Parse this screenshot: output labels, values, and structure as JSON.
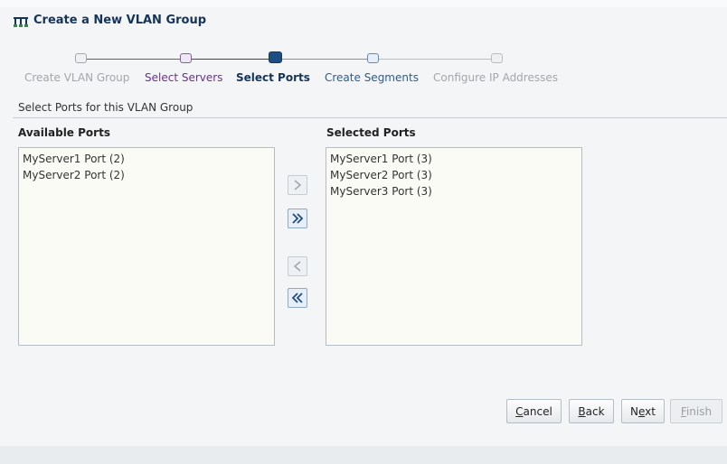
{
  "header": {
    "title": "Create a New VLAN Group",
    "icon": "vlan-group-icon"
  },
  "train": {
    "steps": [
      {
        "label": "Create VLAN Group",
        "state": "disabled"
      },
      {
        "label": "Select Servers",
        "state": "visited"
      },
      {
        "label": "Select Ports",
        "state": "current"
      },
      {
        "label": "Create Segments",
        "state": "next"
      },
      {
        "label": "Configure IP Addresses",
        "state": "disabled"
      }
    ],
    "colors": {
      "visited": "#6b2f8f",
      "current": "#1f4e82",
      "next": "#2b5d8e",
      "disabled": "#a3a7ab"
    }
  },
  "section": {
    "label": "Select Ports for this VLAN Group"
  },
  "available": {
    "header": "Available Ports",
    "items": [
      "MyServer1 Port (2)",
      "MyServer2 Port (2)"
    ]
  },
  "selected": {
    "header": "Selected Ports",
    "items": [
      "MyServer1 Port (3)",
      "MyServer2 Port (3)",
      "MyServer3 Port (3)"
    ]
  },
  "shuttle": {
    "move": {
      "icon": "move-right-icon",
      "enabled": false
    },
    "move_all": {
      "icon": "move-all-right-icon",
      "enabled": true
    },
    "remove": {
      "icon": "move-left-icon",
      "enabled": false
    },
    "remove_all": {
      "icon": "move-all-left-icon",
      "enabled": true
    }
  },
  "buttons": {
    "cancel": {
      "pre": "",
      "key": "C",
      "post": "ancel"
    },
    "back": {
      "pre": "",
      "key": "B",
      "post": "ack"
    },
    "next": {
      "pre": "N",
      "key": "e",
      "post": "xt"
    },
    "finish": {
      "pre": "",
      "key": "F",
      "post": "inish",
      "enabled": false
    }
  }
}
